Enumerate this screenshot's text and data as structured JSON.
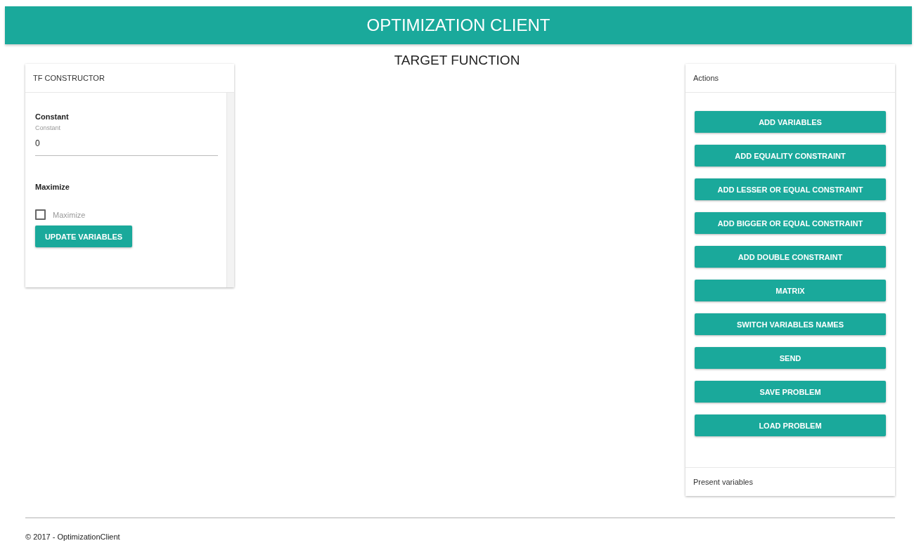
{
  "header": {
    "title": "OPTIMIZATION CLIENT"
  },
  "page_title": "TARGET FUNCTION",
  "tf_constructor": {
    "title": "TF CONSTRUCTOR",
    "constant": {
      "heading": "Constant",
      "label": "Constant",
      "value": "0"
    },
    "maximize": {
      "heading": "Maximize",
      "label": "Maximize",
      "checked": false
    },
    "button": "UPDATE VARIABLES"
  },
  "actions": {
    "title": "Actions",
    "buttons": [
      "ADD VARIABLES",
      "ADD EQUALITY CONSTRAINT",
      "ADD LESSER OR EQUAL CONSTRAINT",
      "ADD BIGGER OR EQUAL CONSTRAINT",
      "ADD DOUBLE CONSTRAINT",
      "MATRIX",
      "SWITCH VARIABLES NAMES",
      "SEND",
      "SAVE PROBLEM",
      "LOAD PROBLEM"
    ],
    "footer": "Present variables"
  },
  "footer": "© 2017 - OptimizationClient"
}
